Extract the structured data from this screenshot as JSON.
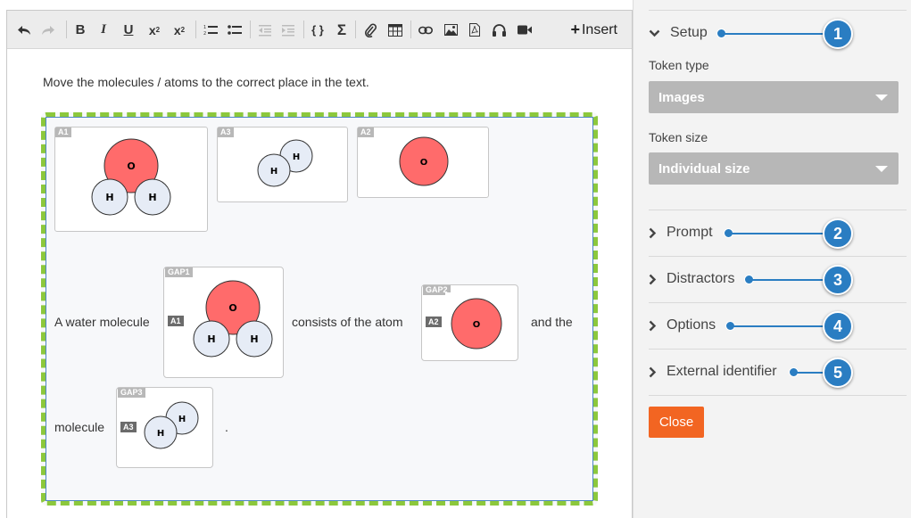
{
  "toolbar": {
    "insert_label": "Insert",
    "icons": [
      "undo-icon",
      "redo-icon",
      "bold-icon",
      "italic-icon",
      "underline-icon",
      "subscript-icon",
      "superscript-icon",
      "ordered-list-icon",
      "unordered-list-icon",
      "outdent-icon",
      "indent-icon",
      "code-icon",
      "sigma-icon",
      "attachment-icon",
      "table-icon",
      "link-icon",
      "image-icon",
      "pdf-icon",
      "audio-icon",
      "video-icon"
    ]
  },
  "editor": {
    "prompt": "Move the molecules / atoms to the correct place in the text.",
    "tokens": [
      {
        "id": "A1",
        "atoms": [
          "O",
          "H",
          "H"
        ]
      },
      {
        "id": "A3",
        "atoms": [
          "H",
          "H"
        ]
      },
      {
        "id": "A2",
        "atoms": [
          "O"
        ]
      }
    ],
    "sentence": {
      "part1": "A water molecule",
      "part2": "consists of the atom",
      "part3": "and the",
      "part4": "molecule",
      "part5": "."
    },
    "gaps": [
      {
        "id": "GAP1",
        "token": "A1"
      },
      {
        "id": "GAP2",
        "token": "A2"
      },
      {
        "id": "GAP3",
        "token": "A3"
      }
    ],
    "colors": {
      "oxygen": "#ff6b6b",
      "hydrogen": "#e6ecf6",
      "dropzone_border": "#8cc83c"
    }
  },
  "panel": {
    "setup": {
      "title": "Setup",
      "token_type_label": "Token type",
      "token_type_value": "Images",
      "token_size_label": "Token size",
      "token_size_value": "Individual size"
    },
    "sections": [
      "Prompt",
      "Distractors",
      "Options",
      "External identifier"
    ],
    "close_label": "Close",
    "callouts": [
      "1",
      "2",
      "3",
      "4",
      "5"
    ],
    "colors": {
      "callout": "#2a7dc2",
      "close": "#f26522",
      "select": "#b7b7b7"
    }
  }
}
